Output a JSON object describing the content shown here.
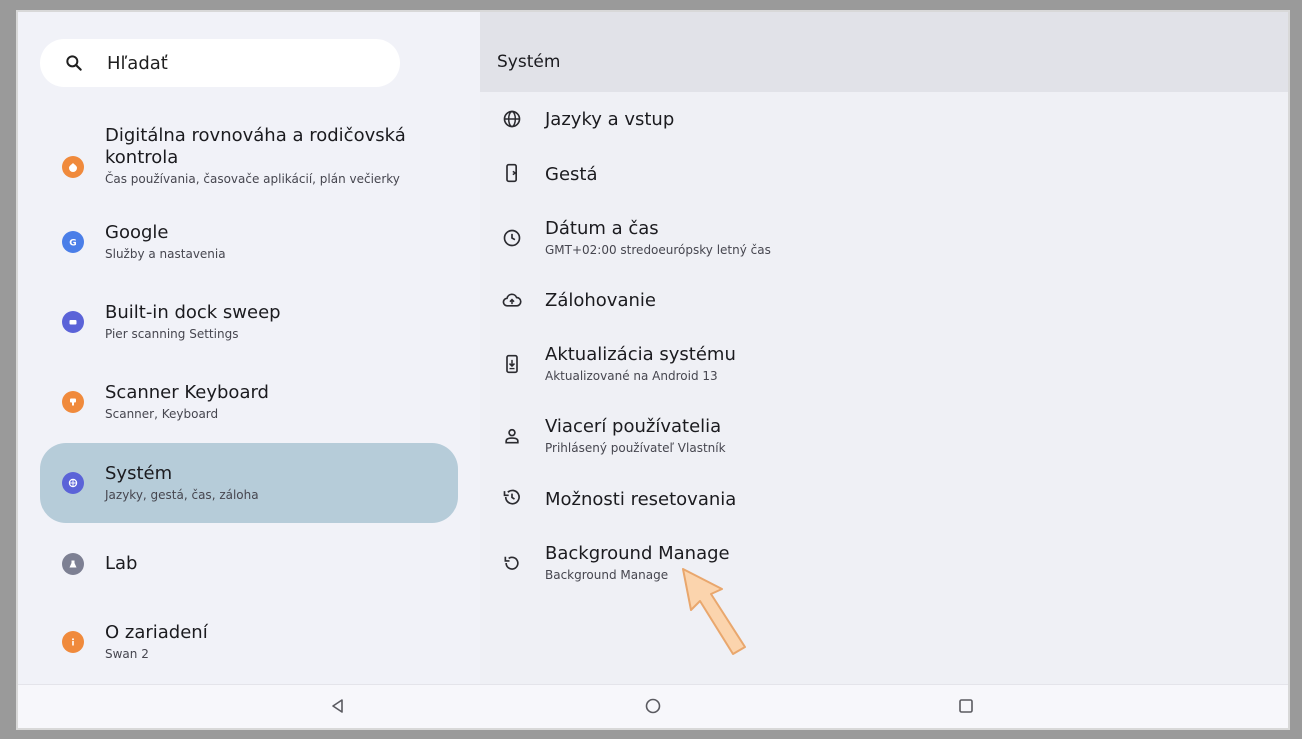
{
  "search": {
    "placeholder": "Hľadať"
  },
  "sidebar": {
    "items": [
      {
        "title": "Digitálna rovnováha a rodičovská kontrola",
        "subtitle": "Čas používania, časovače aplikácií, plán večierky",
        "color": "#f08a3c",
        "icon": "digital-wellbeing-icon"
      },
      {
        "title": "Google",
        "subtitle": "Služby a nastavenia",
        "color": "#4a7ee8",
        "icon": "google-icon"
      },
      {
        "title": "Built-in dock sweep",
        "subtitle": "Pier scanning Settings",
        "color": "#5b63d8",
        "icon": "dock-icon"
      },
      {
        "title": "Scanner Keyboard",
        "subtitle": "Scanner, Keyboard",
        "color": "#f08a3c",
        "icon": "keyboard-icon"
      },
      {
        "title": "Systém",
        "subtitle": "Jazyky, gestá, čas, záloha",
        "color": "#5b63d8",
        "icon": "info-icon",
        "selected": true
      },
      {
        "title": "Lab",
        "subtitle": "",
        "color": "#7d8093",
        "icon": "lab-icon"
      },
      {
        "title": "O zariadení",
        "subtitle": "Swan 2",
        "color": "#f08a3c",
        "icon": "info-icon"
      }
    ]
  },
  "main": {
    "title": "Systém",
    "items": [
      {
        "title": "Jazyky a vstup",
        "subtitle": "",
        "icon": "globe-icon"
      },
      {
        "title": "Gestá",
        "subtitle": "",
        "icon": "gesture-icon"
      },
      {
        "title": "Dátum a čas",
        "subtitle": "GMT+02:00 stredoeurópsky letný čas",
        "icon": "clock-icon"
      },
      {
        "title": "Zálohovanie",
        "subtitle": "",
        "icon": "cloud-upload-icon"
      },
      {
        "title": "Aktualizácia systému",
        "subtitle": "Aktualizované na Android 13",
        "icon": "system-update-icon"
      },
      {
        "title": "Viacerí používatelia",
        "subtitle": "Prihlásený používateľ Vlastník",
        "icon": "person-icon"
      },
      {
        "title": "Možnosti resetovania",
        "subtitle": "",
        "icon": "history-icon"
      },
      {
        "title": "Background Manage",
        "subtitle": "Background Manage",
        "icon": "refresh-icon"
      }
    ]
  },
  "navbar": {
    "buttons": [
      "back-icon",
      "home-icon",
      "recents-icon"
    ]
  },
  "colors": {
    "selected": "#b6ccd9",
    "arrow": "#f7c79a"
  }
}
